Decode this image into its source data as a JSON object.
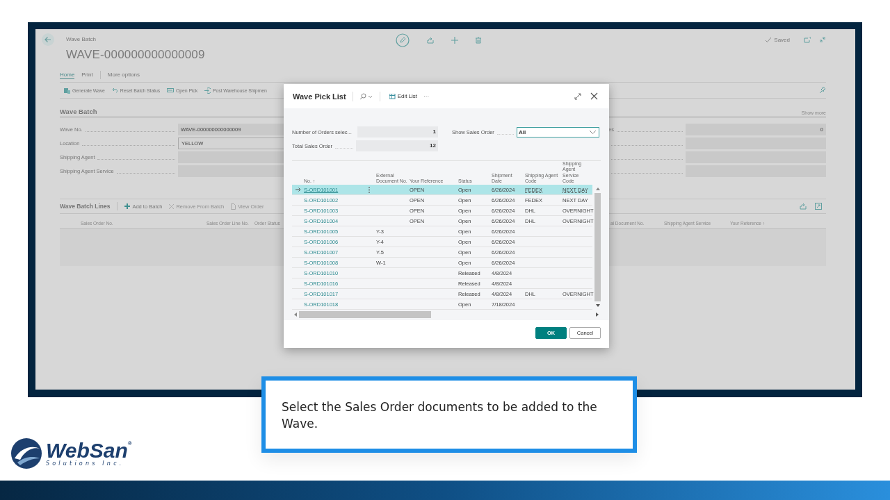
{
  "page": {
    "breadcrumb": "Wave Batch",
    "title": "WAVE-000000000000009",
    "status": "Saved",
    "tabs": [
      {
        "label": "Home",
        "selected": true
      },
      {
        "label": "Print",
        "selected": false
      },
      {
        "label": "More options",
        "selected": false
      }
    ],
    "actions": [
      {
        "label": "Generate Wave",
        "kind": "generate"
      },
      {
        "label": "Reset Batch Status",
        "kind": "reset"
      },
      {
        "label": "Open Pick",
        "kind": "pick"
      },
      {
        "label": "Post Warehouse Shipmen",
        "kind": "post"
      }
    ],
    "section_title": "Wave Batch",
    "show_more": "Show more",
    "fields_left": [
      {
        "label": "Wave No.",
        "value": "WAVE-000000000000009",
        "editable": false
      },
      {
        "label": "Location",
        "value": "YELLOW",
        "editable": true
      },
      {
        "label": "Shipping Agent",
        "editable": false
      },
      {
        "label": "Shipping Agent Service",
        "editable": false
      }
    ],
    "fields_right": [
      {
        "label": "es",
        "value": "0",
        "editable": false
      },
      {
        "editable": false
      },
      {
        "editable": false
      },
      {
        "editable": false
      }
    ],
    "lines": {
      "title": "Wave Batch Lines",
      "actions": [
        {
          "label": "Add to Batch",
          "kind": "add",
          "disabled": false
        },
        {
          "label": "Remove From Batch",
          "kind": "remove",
          "disabled": true
        },
        {
          "label": "View Order",
          "kind": "view",
          "disabled": true
        }
      ],
      "columns_left": [
        "Sales Order No.",
        "Sales Order Line No.",
        "Order Status"
      ],
      "columns_right": [
        "al Document No.",
        "Shipping Agent Service",
        "Your Reference ↑"
      ]
    }
  },
  "dialog": {
    "title": "Wave Pick List",
    "edit_list": "Edit List",
    "more": "···",
    "summary": [
      {
        "label": "Number of Orders selec...",
        "value": "1"
      },
      {
        "label": "Total Sales Order",
        "value": "12"
      }
    ],
    "filter": {
      "label": "Show Sales Order",
      "value": "All"
    },
    "columns": [
      "No. ↑",
      "External Document No.",
      "Your Reference",
      "Status",
      "Shipment Date",
      "Shipping Agent Code",
      "Shipping Agent Service Code"
    ],
    "rows": [
      {
        "selected": true,
        "no": "S-ORD101001",
        "your_reference": "OPEN",
        "status": "Open",
        "shipment_date": "6/26/2024",
        "agent_code": "FEDEX",
        "service_code": "NEXT DAY"
      },
      {
        "selected": false,
        "no": "S-ORD101002",
        "your_reference": "OPEN",
        "status": "Open",
        "shipment_date": "6/26/2024",
        "agent_code": "FEDEX",
        "service_code": "NEXT DAY"
      },
      {
        "selected": false,
        "no": "S-ORD101003",
        "your_reference": "OPEN",
        "status": "Open",
        "shipment_date": "6/26/2024",
        "agent_code": "DHL",
        "service_code": "OVERNIGHT"
      },
      {
        "selected": false,
        "no": "S-ORD101004",
        "your_reference": "OPEN",
        "status": "Open",
        "shipment_date": "6/26/2024",
        "agent_code": "DHL",
        "service_code": "OVERNIGHT"
      },
      {
        "selected": false,
        "no": "S-ORD101005",
        "external_doc": "Y-3",
        "status": "Open",
        "shipment_date": "6/26/2024"
      },
      {
        "selected": false,
        "no": "S-ORD101006",
        "external_doc": "Y-4",
        "status": "Open",
        "shipment_date": "6/26/2024"
      },
      {
        "selected": false,
        "no": "S-ORD101007",
        "external_doc": "Y-5",
        "status": "Open",
        "shipment_date": "6/26/2024"
      },
      {
        "selected": false,
        "no": "S-ORD101008",
        "external_doc": "W-1",
        "status": "Open",
        "shipment_date": "6/26/2024"
      },
      {
        "selected": false,
        "no": "S-ORD101010",
        "status": "Released",
        "shipment_date": "4/8/2024"
      },
      {
        "selected": false,
        "no": "S-ORD101016",
        "status": "Released",
        "shipment_date": "4/8/2024"
      },
      {
        "selected": false,
        "no": "S-ORD101017",
        "status": "Released",
        "shipment_date": "4/8/2024",
        "agent_code": "DHL",
        "service_code": "OVERNIGHT"
      },
      {
        "selected": false,
        "no": "S-ORD101018",
        "status": "Open",
        "shipment_date": "7/18/2024"
      }
    ],
    "buttons": [
      {
        "label": "OK",
        "kind": "primary"
      },
      {
        "label": "Cancel",
        "kind": "secondary"
      }
    ]
  },
  "caption": "Select the Sales Order documents to be added to the Wave.",
  "logo": {
    "name": "WebSan",
    "mark": "®",
    "tagline": "Solutions Inc."
  }
}
